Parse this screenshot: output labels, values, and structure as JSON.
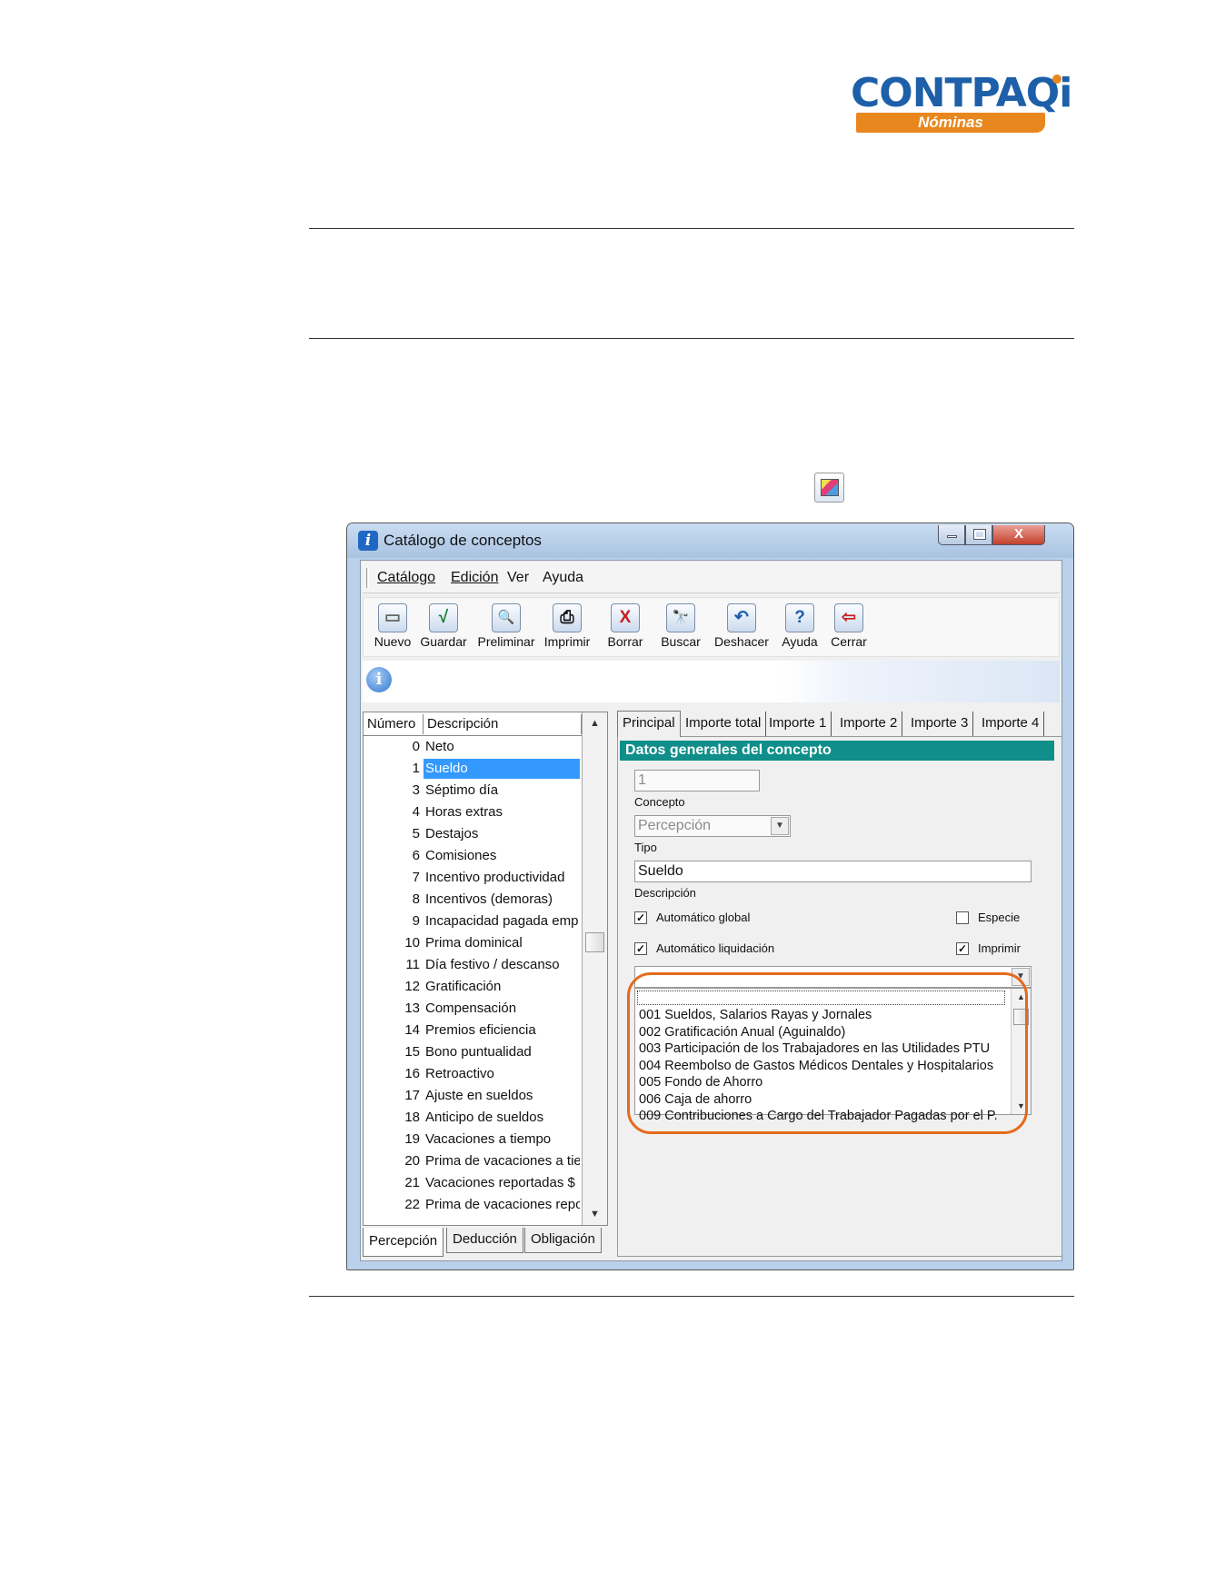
{
  "brand": {
    "name": "CONTPAQ",
    "i": "i",
    "product": "Nóminas",
    "accent": "#e8871e",
    "blue": "#1d5fa8"
  },
  "window": {
    "title": "Catálogo de conceptos",
    "close_glyph": "X",
    "menu": [
      "Catálogo",
      "Edición",
      "Ver",
      "Ayuda"
    ],
    "toolbar": [
      {
        "label": "Nuevo",
        "icon": "new-document-icon",
        "glyph": "▭"
      },
      {
        "label": "Guardar",
        "icon": "checkmark-save-icon",
        "glyph": "√"
      },
      {
        "label": "Preliminar",
        "icon": "print-preview-icon",
        "glyph": "🔍"
      },
      {
        "label": "Imprimir",
        "icon": "printer-icon",
        "glyph": "⎙"
      },
      {
        "label": "Borrar",
        "icon": "delete-x-icon",
        "glyph": "X"
      },
      {
        "label": "Buscar",
        "icon": "binoculars-icon",
        "glyph": "🔭"
      },
      {
        "label": "Deshacer",
        "icon": "undo-icon",
        "glyph": "↶"
      },
      {
        "label": "Ayuda",
        "icon": "help-icon",
        "glyph": "?"
      },
      {
        "label": "Cerrar",
        "icon": "exit-icon",
        "glyph": "⇦"
      }
    ],
    "info_glyph": "i"
  },
  "list": {
    "headers": [
      "Número",
      "Descripción"
    ],
    "rows": [
      {
        "n": "0",
        "d": "Neto"
      },
      {
        "n": "1",
        "d": "Sueldo"
      },
      {
        "n": "3",
        "d": "Séptimo día"
      },
      {
        "n": "4",
        "d": "Horas extras"
      },
      {
        "n": "5",
        "d": "Destajos"
      },
      {
        "n": "6",
        "d": "Comisiones"
      },
      {
        "n": "7",
        "d": "Incentivo productividad"
      },
      {
        "n": "8",
        "d": "Incentivos (demoras)"
      },
      {
        "n": "9",
        "d": "Incapacidad pagada emp"
      },
      {
        "n": "10",
        "d": "Prima dominical"
      },
      {
        "n": "11",
        "d": "Día festivo / descanso"
      },
      {
        "n": "12",
        "d": "Gratificación"
      },
      {
        "n": "13",
        "d": "Compensación"
      },
      {
        "n": "14",
        "d": "Premios eficiencia"
      },
      {
        "n": "15",
        "d": "Bono puntualidad"
      },
      {
        "n": "16",
        "d": "Retroactivo"
      },
      {
        "n": "17",
        "d": "Ajuste en sueldos"
      },
      {
        "n": "18",
        "d": "Anticipo de sueldos"
      },
      {
        "n": "19",
        "d": "Vacaciones a tiempo"
      },
      {
        "n": "20",
        "d": "Prima de vacaciones a tie"
      },
      {
        "n": "21",
        "d": "Vacaciones reportadas $"
      },
      {
        "n": "22",
        "d": "Prima de vacaciones repo"
      }
    ],
    "selected_index": 1,
    "tabs": [
      "Percepción",
      "Deducción",
      "Obligación"
    ],
    "active_tab": "Percepción"
  },
  "detail": {
    "tabs": [
      "Principal",
      "Importe total",
      "Importe 1",
      "Importe 2",
      "Importe 3",
      "Importe 4"
    ],
    "active_tab": "Principal",
    "section_title": "Datos generales del concepto",
    "concepto_value": "1",
    "concepto_label": "Concepto",
    "tipo_value": "Percepción",
    "tipo_label": "Tipo",
    "descripcion_value": "Sueldo",
    "descripcion_label": "Descripción",
    "checks": {
      "automatico_global": {
        "label": "Automático global",
        "checked": "✓"
      },
      "especie": {
        "label": "Especie",
        "checked": ""
      },
      "automatico_liquidacion": {
        "label": "Automático liquidación",
        "checked": "✓"
      },
      "imprimir": {
        "label": "Imprimir",
        "checked": "✓"
      }
    },
    "sat_options": [
      "001  Sueldos, Salarios  Rayas y Jornales",
      "002  Gratificación Anual (Aguinaldo)",
      "003  Participación de los Trabajadores en las Utilidades PTU",
      "004  Reembolso de Gastos Médicos Dentales y Hospitalarios",
      "005  Fondo de Ahorro",
      "006  Caja de ahorro",
      "009  Contribuciones a Cargo del Trabajador Pagadas por el P."
    ],
    "highlight_color": "#e56a1c"
  }
}
